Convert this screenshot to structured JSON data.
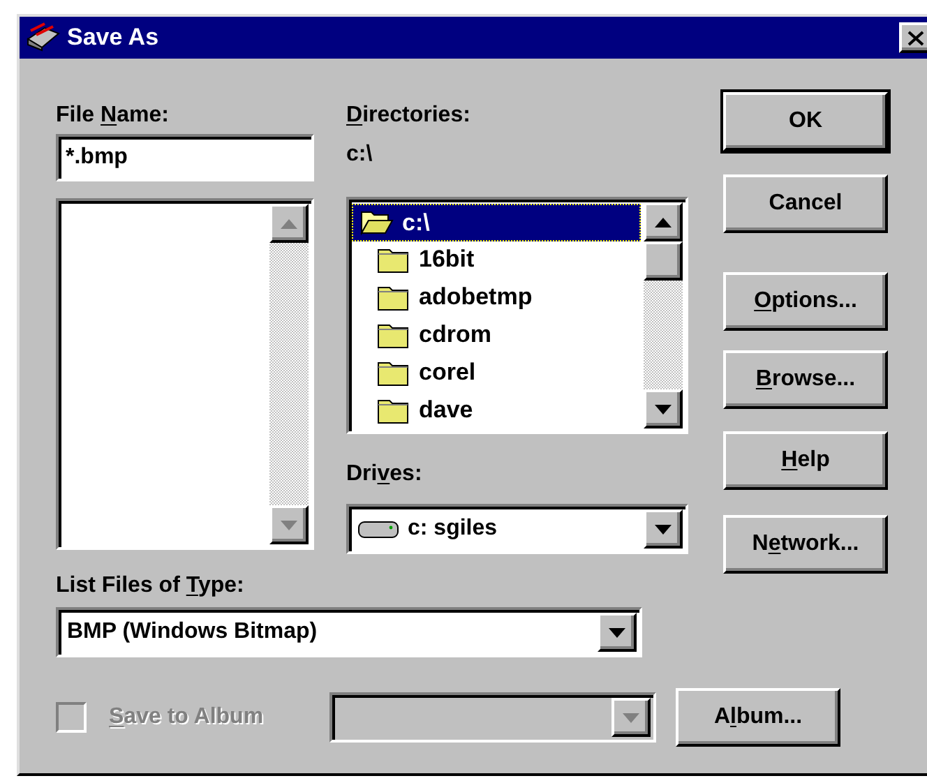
{
  "window": {
    "title": "Save As"
  },
  "file_name": {
    "label": {
      "pre": "File ",
      "key": "N",
      "post": "ame:"
    },
    "value": "*.bmp"
  },
  "file_list": {
    "scrollbar_disabled": true
  },
  "directories": {
    "label": {
      "key": "D",
      "post": "irectories:"
    },
    "path": "c:\\",
    "items": [
      {
        "name": "c:\\",
        "selected": true,
        "expanded": true,
        "children": [
          {
            "name": "16bit",
            "selected": false,
            "expanded": false
          },
          {
            "name": "adobetmp",
            "selected": false,
            "expanded": false
          },
          {
            "name": "cdrom",
            "selected": false,
            "expanded": false
          },
          {
            "name": "corel",
            "selected": false,
            "expanded": false
          },
          {
            "name": "dave",
            "selected": false,
            "expanded": false
          }
        ]
      }
    ]
  },
  "drives": {
    "label": {
      "pre": "Dri",
      "key": "v",
      "post": "es:"
    },
    "value": "c:  sgiles"
  },
  "file_type": {
    "label": {
      "pre": "List Files of ",
      "key": "T",
      "post": "ype:"
    },
    "value": "BMP (Windows Bitmap)"
  },
  "save_to_album": {
    "label": {
      "key": "S",
      "post": "ave to Album"
    },
    "checked": false,
    "disabled": true
  },
  "album_select": {
    "disabled": true
  },
  "buttons": [
    {
      "label": {
        "pre": "OK"
      },
      "default": true
    },
    {
      "label": {
        "pre": "Cancel"
      },
      "default": false
    },
    {
      "label": {
        "key": "O",
        "post": "ptions..."
      },
      "default": false
    },
    {
      "label": {
        "key": "B",
        "post": "rowse..."
      },
      "default": false
    },
    {
      "label": {
        "key": "H",
        "post": "elp"
      },
      "default": false
    },
    {
      "label": {
        "pre": "N",
        "key": "e",
        "post": "twork..."
      },
      "default": false
    }
  ],
  "album_button": {
    "label": {
      "pre": "A",
      "key": "l",
      "post": "bum..."
    }
  }
}
